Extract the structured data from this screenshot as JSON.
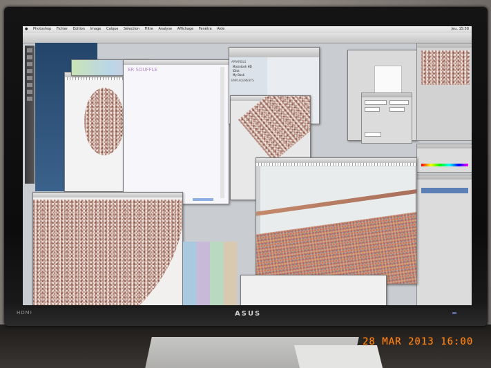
{
  "scene": {
    "monitor_brand": "ASUS",
    "monitor_port_label": "HDMI",
    "timestamp": "28 MAR 2013 16:00"
  },
  "screen": {
    "menubar": [
      "Photoshop",
      "Fichier",
      "Edition",
      "Image",
      "Calque",
      "Sélection",
      "Filtre",
      "Analyse",
      "Affichage",
      "Fenêtre",
      "Aide"
    ],
    "menubar_right": "Jeu. 15:58",
    "sidebar_heading_devices": "APPAREILS",
    "sidebar_heading_places": "EMPLACEMENTS",
    "sidebar_items": [
      "Macintosh HD",
      "iDisk",
      "My Book"
    ],
    "window_text_soufflé": "ER SOUFFLE"
  },
  "colors": {
    "timestamp": "#ff8a1e",
    "desktop": "#2c4f78",
    "bezel": "#111111"
  }
}
